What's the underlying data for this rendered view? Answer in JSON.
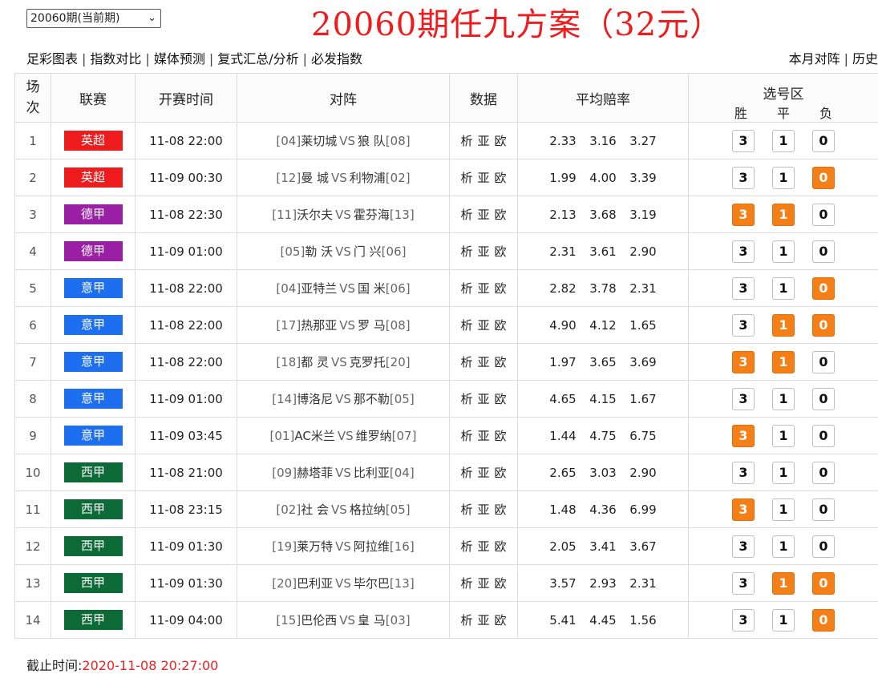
{
  "period_select": {
    "value": "20060期(当前期)"
  },
  "title": "20060期任九方案（32元）",
  "nav": {
    "left": [
      "足彩图表",
      "指数对比",
      "媒体预测",
      "复式汇总/分析",
      "必发指数"
    ],
    "right": [
      "本月对阵",
      "历史"
    ]
  },
  "headers": {
    "idx": "场次",
    "league": "联赛",
    "time": "开赛时间",
    "match": "对阵",
    "data": "数据",
    "odds": "平均赔率",
    "select": "选号区",
    "win": "胜",
    "draw": "平",
    "lose": "负"
  },
  "data_links": [
    "析",
    "亚",
    "欧"
  ],
  "pick_labels": [
    "3",
    "1",
    "0"
  ],
  "colors": {
    "accent": "#f57f17",
    "title_red": "#ee1c1c",
    "league": {
      "英超": "#ee1c1c",
      "德甲": "#9b1fa4",
      "意甲": "#1e6ff0",
      "西甲": "#0b6a35"
    }
  },
  "rows": [
    {
      "idx": "1",
      "league": "英超",
      "time": "11-08 22:00",
      "home_rank": "[04]",
      "home": "莱切城",
      "away": "狼 队",
      "away_rank": "[08]",
      "odds": [
        "2.33",
        "3.16",
        "3.27"
      ],
      "picks": [
        false,
        false,
        false
      ]
    },
    {
      "idx": "2",
      "league": "英超",
      "time": "11-09 00:30",
      "home_rank": "[12]",
      "home": "曼 城",
      "away": "利物浦",
      "away_rank": "[02]",
      "odds": [
        "1.99",
        "4.00",
        "3.39"
      ],
      "picks": [
        false,
        false,
        true
      ]
    },
    {
      "idx": "3",
      "league": "德甲",
      "time": "11-08 22:30",
      "home_rank": "[11]",
      "home": "沃尔夫",
      "away": "霍芬海",
      "away_rank": "[13]",
      "odds": [
        "2.13",
        "3.68",
        "3.19"
      ],
      "picks": [
        true,
        true,
        false
      ]
    },
    {
      "idx": "4",
      "league": "德甲",
      "time": "11-09 01:00",
      "home_rank": "[05]",
      "home": "勒 沃",
      "away": "门 兴",
      "away_rank": "[06]",
      "odds": [
        "2.31",
        "3.61",
        "2.90"
      ],
      "picks": [
        false,
        false,
        false
      ]
    },
    {
      "idx": "5",
      "league": "意甲",
      "time": "11-08 22:00",
      "home_rank": "[04]",
      "home": "亚特兰",
      "away": "国 米",
      "away_rank": "[06]",
      "odds": [
        "2.82",
        "3.78",
        "2.31"
      ],
      "picks": [
        false,
        false,
        true
      ]
    },
    {
      "idx": "6",
      "league": "意甲",
      "time": "11-08 22:00",
      "home_rank": "[17]",
      "home": "热那亚",
      "away": "罗 马",
      "away_rank": "[08]",
      "odds": [
        "4.90",
        "4.12",
        "1.65"
      ],
      "picks": [
        false,
        true,
        true
      ]
    },
    {
      "idx": "7",
      "league": "意甲",
      "time": "11-08 22:00",
      "home_rank": "[18]",
      "home": "都 灵",
      "away": "克罗托",
      "away_rank": "[20]",
      "odds": [
        "1.97",
        "3.65",
        "3.69"
      ],
      "picks": [
        true,
        true,
        false
      ]
    },
    {
      "idx": "8",
      "league": "意甲",
      "time": "11-09 01:00",
      "home_rank": "[14]",
      "home": "博洛尼",
      "away": "那不勒",
      "away_rank": "[05]",
      "odds": [
        "4.65",
        "4.15",
        "1.67"
      ],
      "picks": [
        false,
        false,
        false
      ]
    },
    {
      "idx": "9",
      "league": "意甲",
      "time": "11-09 03:45",
      "home_rank": "[01]",
      "home": "AC米兰",
      "away": "维罗纳",
      "away_rank": "[07]",
      "odds": [
        "1.44",
        "4.75",
        "6.75"
      ],
      "picks": [
        true,
        false,
        false
      ]
    },
    {
      "idx": "10",
      "league": "西甲",
      "time": "11-08 21:00",
      "home_rank": "[09]",
      "home": "赫塔菲",
      "away": "比利亚",
      "away_rank": "[04]",
      "odds": [
        "2.65",
        "3.03",
        "2.90"
      ],
      "picks": [
        false,
        false,
        false
      ]
    },
    {
      "idx": "11",
      "league": "西甲",
      "time": "11-08 23:15",
      "home_rank": "[02]",
      "home": "社 会",
      "away": "格拉纳",
      "away_rank": "[05]",
      "odds": [
        "1.48",
        "4.36",
        "6.99"
      ],
      "picks": [
        true,
        false,
        false
      ]
    },
    {
      "idx": "12",
      "league": "西甲",
      "time": "11-09 01:30",
      "home_rank": "[19]",
      "home": "莱万特",
      "away": "阿拉维",
      "away_rank": "[16]",
      "odds": [
        "2.05",
        "3.41",
        "3.67"
      ],
      "picks": [
        false,
        false,
        false
      ]
    },
    {
      "idx": "13",
      "league": "西甲",
      "time": "11-09 01:30",
      "home_rank": "[20]",
      "home": "巴利亚",
      "away": "毕尔巴",
      "away_rank": "[13]",
      "odds": [
        "3.57",
        "2.93",
        "2.31"
      ],
      "picks": [
        false,
        true,
        true
      ]
    },
    {
      "idx": "14",
      "league": "西甲",
      "time": "11-09 04:00",
      "home_rank": "[15]",
      "home": "巴伦西",
      "away": "皇 马",
      "away_rank": "[03]",
      "odds": [
        "5.41",
        "4.45",
        "1.56"
      ],
      "picks": [
        false,
        false,
        true
      ]
    }
  ],
  "footer": {
    "label": "截止时间:",
    "time": "2020-11-08 20:27:00"
  }
}
